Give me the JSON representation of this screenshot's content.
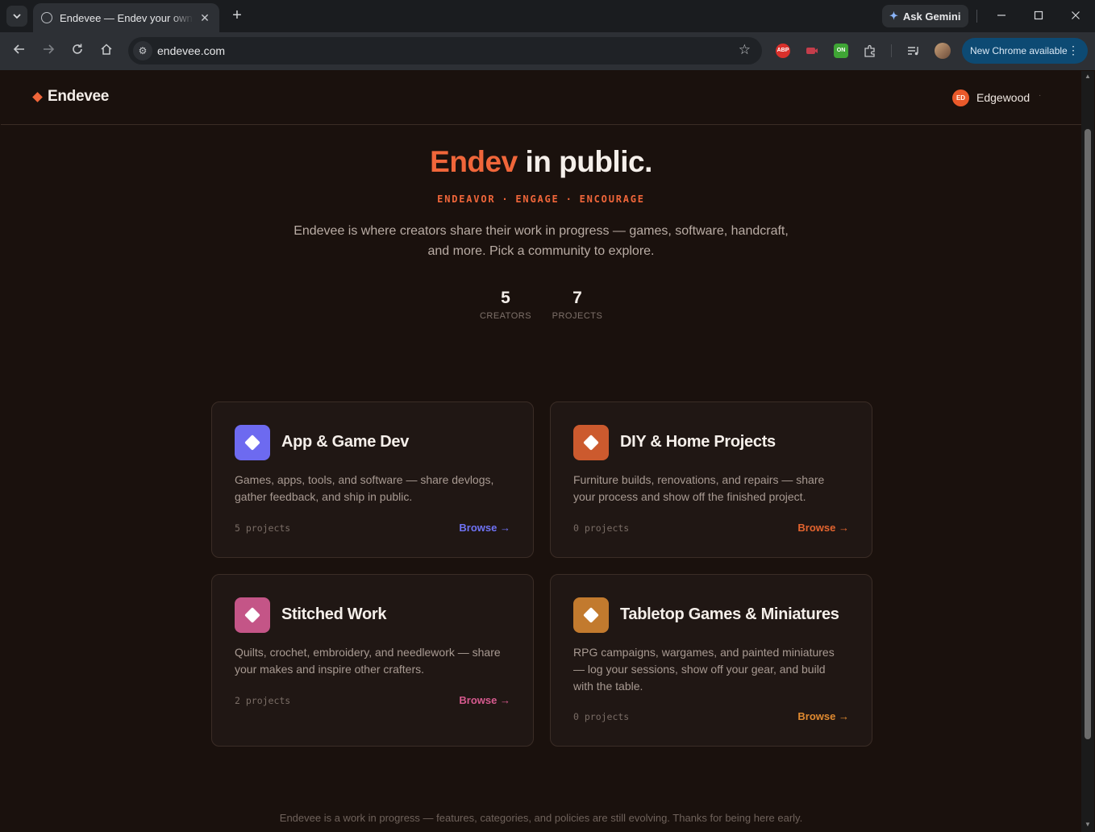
{
  "browser": {
    "tab_title": "Endevee — Endev your own projects",
    "tab_close": "✕",
    "new_tab": "+",
    "gemini_label": "Ask Gemini",
    "url": "endevee.com",
    "update_label": "New Chrome available",
    "extensions": [
      {
        "name": "adblock-plus-icon",
        "text": "ABP",
        "color": "#d9302b"
      },
      {
        "name": "screen-recorder-icon",
        "text": "",
        "color": "#c43d4b"
      },
      {
        "name": "on-extension-icon",
        "text": "ON",
        "color": "#3fa535"
      }
    ]
  },
  "site": {
    "logo": "Endevee",
    "user": {
      "initials": "ED",
      "name": "Edgewood"
    }
  },
  "hero": {
    "title_accent": "Endev",
    "title_rest": " in public.",
    "tagline": [
      "ENDEAVOR",
      "ENGAGE",
      "ENCOURAGE"
    ],
    "tagline_dot": "·",
    "description": "Endevee is where creators share their work in progress — games, software, handcraft, and more. Pick a community to explore.",
    "stats": [
      {
        "value": "5",
        "label": "CREATORS"
      },
      {
        "value": "7",
        "label": "PROJECTS"
      }
    ]
  },
  "communities": [
    {
      "title": "App & Game Dev",
      "description": "Games, apps, tools, and software — share devlogs, gather feedback, and ship in public.",
      "count": "5 projects",
      "browse": "Browse →",
      "color": "#6d6af0",
      "browse_color": "#6f73f5"
    },
    {
      "title": "DIY & Home Projects",
      "description": "Furniture builds, renovations, and repairs — share your process and show off the finished project.",
      "count": "0 projects",
      "browse": "Browse →",
      "color": "#cc5a2e",
      "browse_color": "#e3642f"
    },
    {
      "title": "Stitched Work",
      "description": "Quilts, crochet, embroidery, and needlework — share your makes and inspire other crafters.",
      "count": "2 projects",
      "browse": "Browse →",
      "color": "#c45587",
      "browse_color": "#d75a8f"
    },
    {
      "title": "Tabletop Games & Miniatures",
      "description": "RPG campaigns, wargames, and painted miniatures — log your sessions, show off your gear, and build with the table.",
      "count": "0 projects",
      "browse": "Browse →",
      "color": "#c27a2e",
      "browse_color": "#e08a30"
    }
  ],
  "footer": "Endevee is a work in progress — features, categories, and policies are still evolving. Thanks for being here early."
}
